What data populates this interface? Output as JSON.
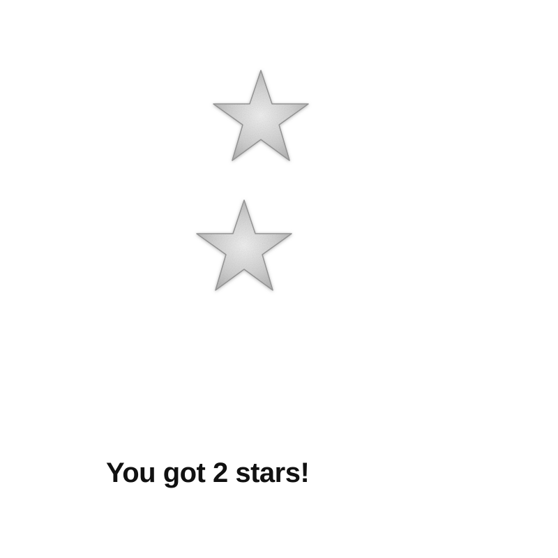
{
  "game": {
    "star_count": 2,
    "star_icon": "silver-glitter-star-icon",
    "result_message": "You got 2 stars!"
  },
  "colors": {
    "background": "#ffffff",
    "star_fill_light": "#e6e6e6",
    "star_fill_dark": "#9a9a9a",
    "star_edge": "#8c8c8c",
    "text": "#111111"
  }
}
